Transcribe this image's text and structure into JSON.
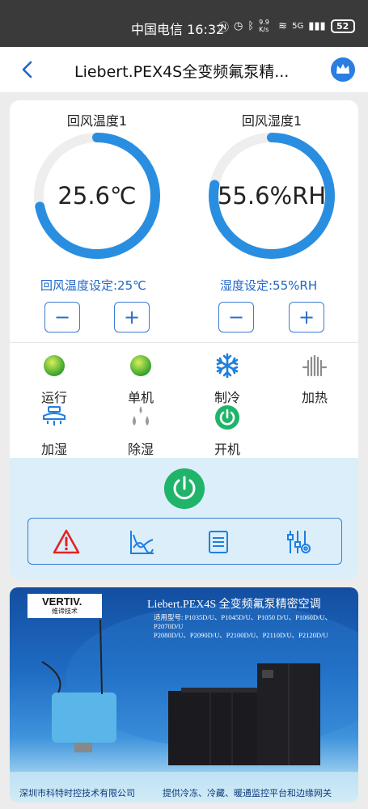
{
  "status_bar": {
    "carrier_time": "中国电信 16:32",
    "net_speed": "9.9 K/s",
    "signal": "5G",
    "battery": "52"
  },
  "header": {
    "title": "Liebert.PEX4S全变频氟泵精...",
    "back_icon": "chevron-left-icon",
    "vip_icon": "crown-icon"
  },
  "gauges": [
    {
      "label": "回风温度1",
      "value": "25.6℃",
      "fill": 0.72,
      "setpoint": "回风温度设定:25℃",
      "minus": "−",
      "plus": "+"
    },
    {
      "label": "回风湿度1",
      "value": "55.6%RH",
      "fill": 0.78,
      "setpoint": "湿度设定:55%RH",
      "minus": "−",
      "plus": "+"
    }
  ],
  "states": [
    {
      "label": "运行",
      "icon": "green-indicator-icon"
    },
    {
      "label": "单机",
      "icon": "green-indicator-icon"
    },
    {
      "label": "制冷",
      "icon": "snowflake-icon"
    },
    {
      "label": "加热",
      "icon": "heater-icon"
    },
    {
      "label": "加湿",
      "icon": "humidifier-icon"
    },
    {
      "label": "除湿",
      "icon": "droplets-icon"
    },
    {
      "label": "开机",
      "icon": "power-on-icon"
    }
  ],
  "toolbar": {
    "icons": [
      "alarm-icon",
      "trend-chart-icon",
      "list-icon",
      "settings-sliders-icon"
    ]
  },
  "banner": {
    "brand": "VERTIV.",
    "brand_sub": "维谛技术",
    "title": "Liebert.PEX4S 全变频氟泵精密空调",
    "models_line1": "适用型号: P1035D/U、P1045D/U、P1050 D/U、P1060D/U、P2070D/U",
    "models_line2": "P2080D/U、P2090D/U、P2100D/U、P2110D/U、P2120D/U",
    "footer_left": "深圳市科特时控技术有限公司",
    "footer_right": "提供冷冻、冷藏、暖通监控平台和边缘网关"
  },
  "colors": {
    "accent": "#1f66c9",
    "gauge_track": "#eeeeee",
    "gauge_arc": "#2a8ee0",
    "run_green": "#1fb46a",
    "alarm_red": "#e02424",
    "zone_bg": "#dbeefa"
  }
}
